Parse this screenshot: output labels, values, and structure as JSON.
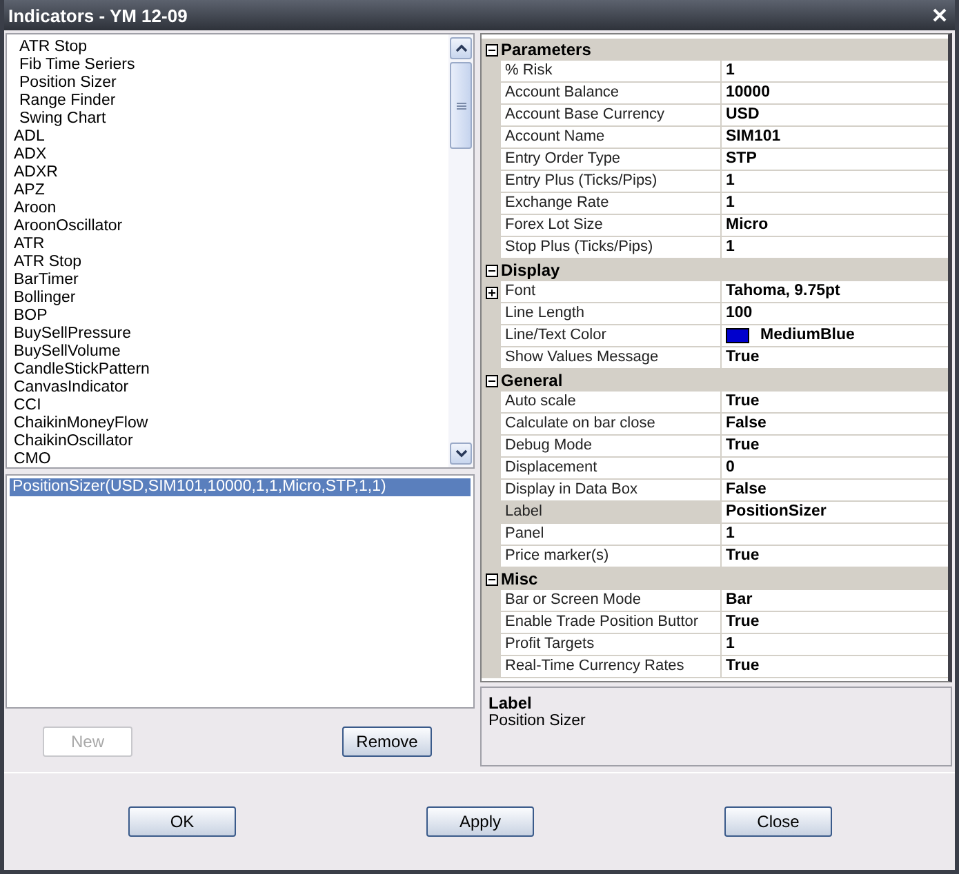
{
  "window": {
    "title": "Indicators - YM 12-09"
  },
  "indicators": [
    {
      "label": "ATR Stop",
      "indented": true,
      "selected": false
    },
    {
      "label": "Fib Time Seriers",
      "indented": true,
      "selected": false
    },
    {
      "label": "Position Sizer",
      "indented": true,
      "selected": false
    },
    {
      "label": "Range Finder",
      "indented": true,
      "selected": false
    },
    {
      "label": "Swing Chart",
      "indented": true,
      "selected": false
    },
    {
      "label": "ADL",
      "indented": false,
      "selected": false
    },
    {
      "label": "ADX",
      "indented": false,
      "selected": false
    },
    {
      "label": "ADXR",
      "indented": false,
      "selected": false
    },
    {
      "label": "APZ",
      "indented": false,
      "selected": false
    },
    {
      "label": "Aroon",
      "indented": false,
      "selected": false
    },
    {
      "label": "AroonOscillator",
      "indented": false,
      "selected": false
    },
    {
      "label": "ATR",
      "indented": false,
      "selected": false
    },
    {
      "label": "ATR Stop",
      "indented": false,
      "selected": false
    },
    {
      "label": "BarTimer",
      "indented": false,
      "selected": false
    },
    {
      "label": "Bollinger",
      "indented": false,
      "selected": false
    },
    {
      "label": "BOP",
      "indented": false,
      "selected": false
    },
    {
      "label": "BuySellPressure",
      "indented": false,
      "selected": false
    },
    {
      "label": "BuySellVolume",
      "indented": false,
      "selected": false
    },
    {
      "label": "CandleStickPattern",
      "indented": false,
      "selected": false
    },
    {
      "label": "CanvasIndicator",
      "indented": false,
      "selected": false
    },
    {
      "label": "CCI",
      "indented": false,
      "selected": false
    },
    {
      "label": "ChaikinMoneyFlow",
      "indented": false,
      "selected": false
    },
    {
      "label": "ChaikinOscillator",
      "indented": false,
      "selected": false
    },
    {
      "label": "CMO",
      "indented": false,
      "selected": false
    }
  ],
  "applied": [
    {
      "label": "PositionSizer(USD,SIM101,10000,1,1,Micro,STP,1,1)",
      "selected": true
    }
  ],
  "list_buttons": [
    {
      "label": "New",
      "disabled": true
    },
    {
      "label": "Remove",
      "disabled": false
    }
  ],
  "properties": [
    {
      "category": "Parameters",
      "expanded": true,
      "rows": [
        {
          "name": "% Risk",
          "value": "1",
          "kind": "text",
          "selected": false
        },
        {
          "name": "Account Balance",
          "value": "10000",
          "kind": "text",
          "selected": false
        },
        {
          "name": "Account Base Currency",
          "value": "USD",
          "kind": "text",
          "selected": false
        },
        {
          "name": "Account Name",
          "value": "SIM101",
          "kind": "text",
          "selected": false
        },
        {
          "name": "Entry Order Type",
          "value": "STP",
          "kind": "text",
          "selected": false
        },
        {
          "name": "Entry Plus (Ticks/Pips)",
          "value": "1",
          "kind": "text",
          "selected": false
        },
        {
          "name": "Exchange Rate",
          "value": "1",
          "kind": "text",
          "selected": false
        },
        {
          "name": "Forex Lot Size",
          "value": "Micro",
          "kind": "text",
          "selected": false
        },
        {
          "name": "Stop Plus (Ticks/Pips)",
          "value": "1",
          "kind": "text",
          "selected": false
        }
      ]
    },
    {
      "category": "Display",
      "expanded": true,
      "rows": [
        {
          "name": "Font",
          "value": "Tahoma, 9.75pt",
          "kind": "group",
          "selected": false
        },
        {
          "name": "Line Length",
          "value": "100",
          "kind": "text",
          "selected": false
        },
        {
          "name": "Line/Text Color",
          "value": "MediumBlue",
          "kind": "color",
          "color": "#0000cd",
          "selected": false
        },
        {
          "name": "Show Values Message",
          "value": "True",
          "kind": "text",
          "selected": false
        }
      ]
    },
    {
      "category": "General",
      "expanded": true,
      "rows": [
        {
          "name": "Auto scale",
          "value": "True",
          "kind": "text",
          "selected": false
        },
        {
          "name": "Calculate on bar close",
          "value": "False",
          "kind": "text",
          "selected": false
        },
        {
          "name": "Debug Mode",
          "value": "True",
          "kind": "text",
          "selected": false
        },
        {
          "name": "Displacement",
          "value": "0",
          "kind": "text",
          "selected": false
        },
        {
          "name": "Display in Data Box",
          "value": "False",
          "kind": "text",
          "selected": false
        },
        {
          "name": "Label",
          "value": "PositionSizer",
          "kind": "text",
          "selected": true
        },
        {
          "name": "Panel",
          "value": "1",
          "kind": "text",
          "selected": false
        },
        {
          "name": "Price marker(s)",
          "value": "True",
          "kind": "text",
          "selected": false
        }
      ]
    },
    {
      "category": "Misc",
      "expanded": true,
      "rows": [
        {
          "name": "Bar or Screen Mode",
          "value": "Bar",
          "kind": "text",
          "selected": false
        },
        {
          "name": "Enable Trade Position Buttor",
          "value": "True",
          "kind": "text",
          "selected": false
        },
        {
          "name": "Profit Targets",
          "value": "1",
          "kind": "text",
          "selected": false
        },
        {
          "name": "Real-Time Currency Rates",
          "value": "True",
          "kind": "text",
          "selected": false
        }
      ]
    }
  ],
  "description": {
    "title": "Label",
    "text": "Position Sizer"
  },
  "dialog_buttons": [
    {
      "label": "OK"
    },
    {
      "label": "Apply"
    },
    {
      "label": "Close"
    }
  ]
}
